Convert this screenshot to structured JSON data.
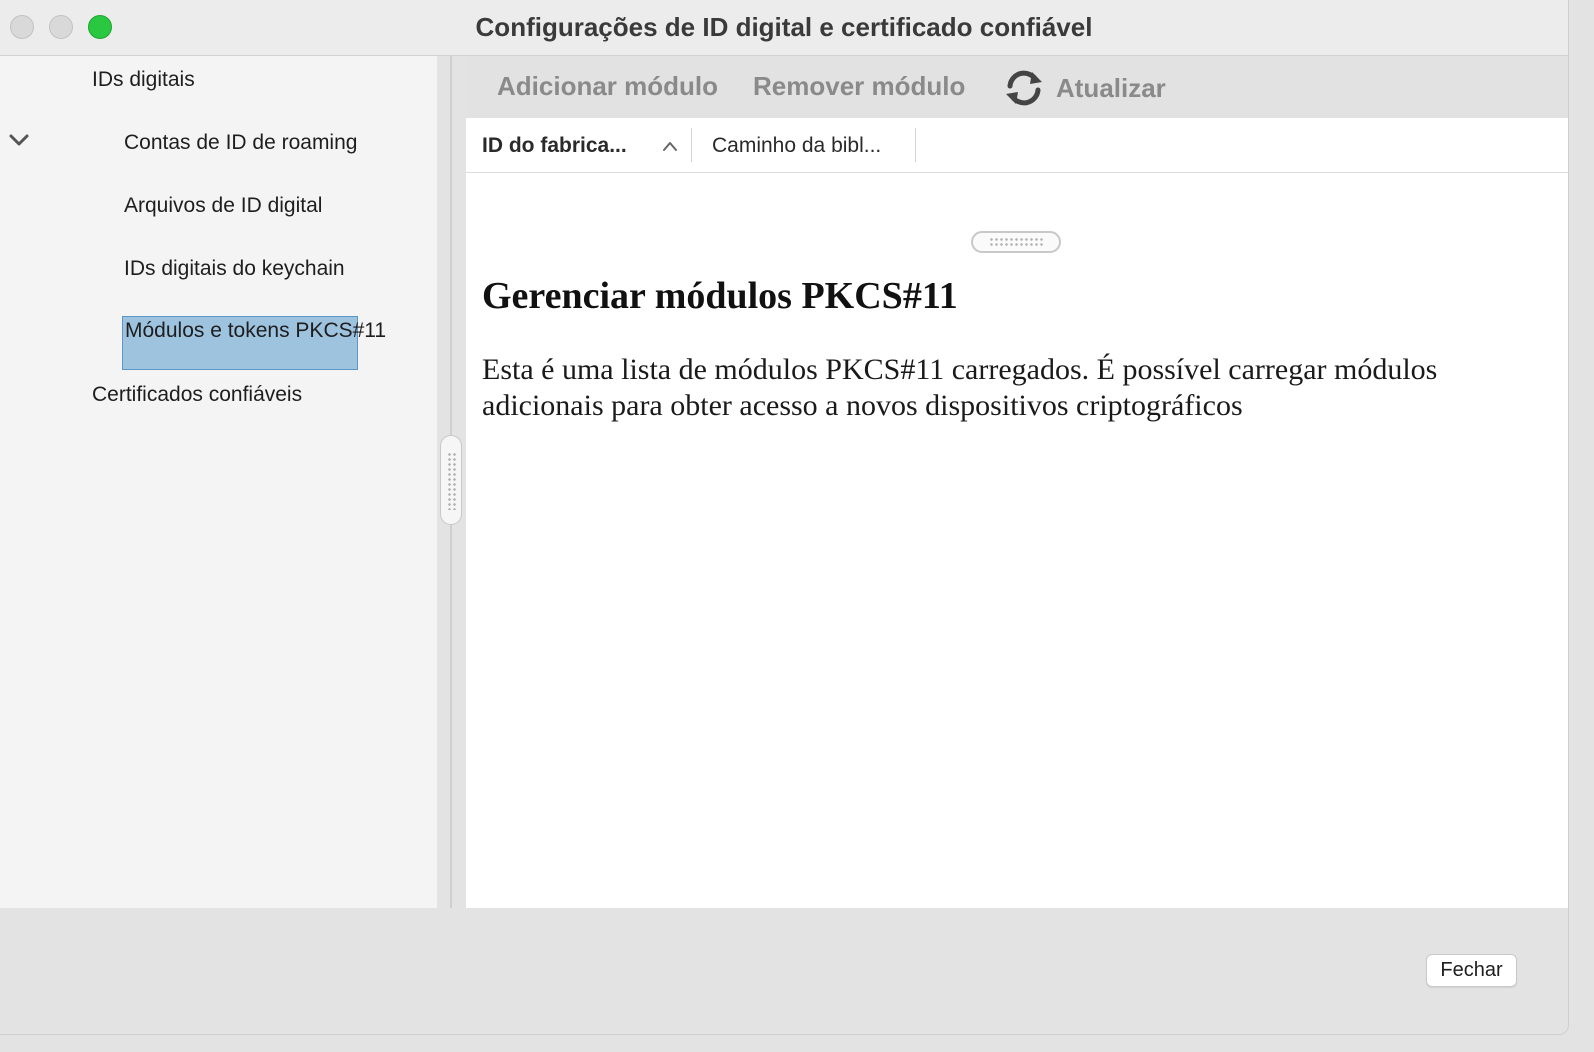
{
  "window": {
    "title": "Configurações de ID digital e certificado confiável"
  },
  "sidebar": {
    "items": [
      {
        "label": "IDs digitais",
        "level": 0,
        "expanded": true
      },
      {
        "label": "Contas de ID de roaming",
        "level": 1
      },
      {
        "label": "Arquivos de ID digital",
        "level": 1
      },
      {
        "label": "IDs digitais do keychain",
        "level": 1
      },
      {
        "label": "Módulos e tokens PKCS#11",
        "level": 1,
        "selected": true
      },
      {
        "label": "Certificados confiáveis",
        "level": 0
      }
    ],
    "selected_color": "#9dc3df"
  },
  "toolbar": {
    "add_label": "Adicionar módulo",
    "remove_label": "Remover módulo",
    "refresh_label": "Atualizar",
    "refresh_icon": "refresh-icon"
  },
  "table": {
    "columns": [
      "ID do fabrica...",
      "Caminho da bibl..."
    ],
    "sort_icon": "chevron-up-icon"
  },
  "content": {
    "heading": "Gerenciar módulos PKCS#11",
    "description": "Esta é uma lista de módulos PKCS#11 carregados. É possível carregar módulos adicionais para obter acesso a novos dispositivos criptográficos"
  },
  "footer": {
    "close_label": "Fechar"
  }
}
